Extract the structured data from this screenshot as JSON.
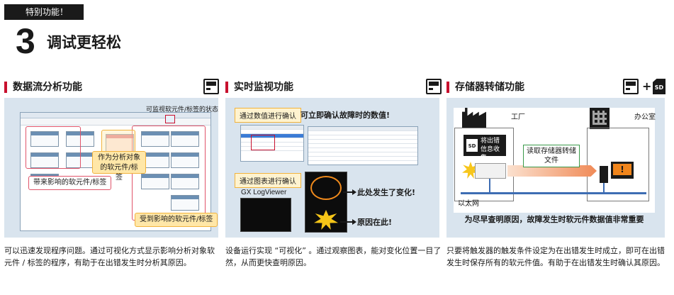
{
  "header": {
    "tag": "特别功能！",
    "number": "3",
    "title": "调试更轻松"
  },
  "sections": [
    {
      "title": "数据流分析功能",
      "icon": "plc-icon",
      "panel": {
        "note": "可监视软元件/标签的状态",
        "callout_target": "作为分析对象的软元件/标签",
        "callout_affecting": "带来影响的软元件/标签",
        "callout_affected": "受到影响的软元件/标签"
      },
      "description": "可以迅速发现程序问题。通过可视化方式显示影响分析对象软元件 / 标签的程序，有助于在出错发生时分析其原因。"
    },
    {
      "title": "实时监视功能",
      "icon": "plc-icon",
      "panel": {
        "numeric_tag": "通过数值进行确认",
        "numeric_caption": "可立即确认故障时的数值!",
        "chart_tag": "通过图表进行确认",
        "app_name": "GX LogViewer",
        "changed": "此处发生了变化!",
        "cause": "原因在此!"
      },
      "description": "设备运行实现 “可视化” 。通过观察图表，能对变化位置一目了然，从而更快查明原因。"
    },
    {
      "title": "存储器转储功能",
      "icon": "plc-icon",
      "icon2": "sd-card-icon",
      "icon2_label": "SD",
      "plus": "+",
      "panel": {
        "factory": "工厂",
        "office": "办公室",
        "sd_label": "将出错信息收集",
        "read_label": "读取存储器转储文件",
        "ethernet": "以太网",
        "monitor_mark": "!",
        "footer": "为尽早查明原因，故障发生时软元件数据值非常重要"
      },
      "description": "只要将触发器的触发条件设定为在出错发生时成立，即可在出错发生时保存所有的软元件值。有助于在出错发生时确认其原因。"
    }
  ]
}
